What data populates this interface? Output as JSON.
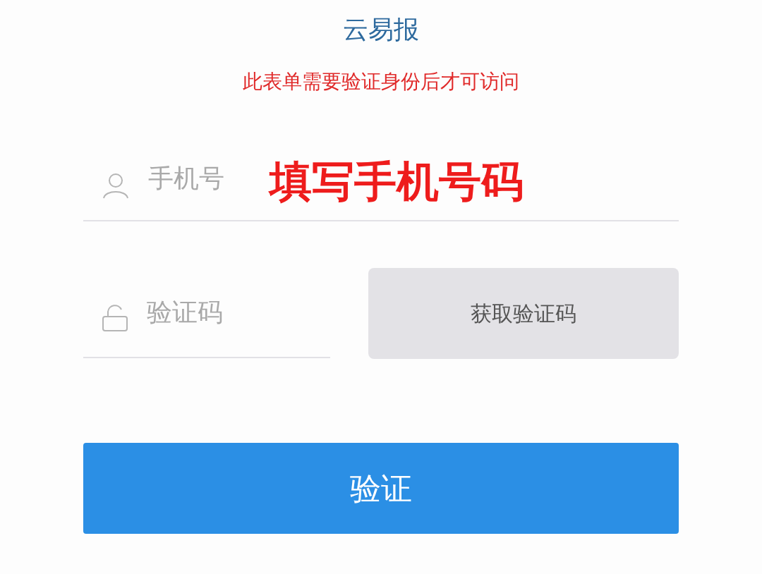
{
  "title": "云易报",
  "notice": "此表单需要验证身份后才可访问",
  "phone_field": {
    "placeholder": "手机号"
  },
  "annotation": "填写手机号码",
  "code_field": {
    "placeholder": "验证码"
  },
  "get_code_button": "获取验证码",
  "verify_button": "验证"
}
